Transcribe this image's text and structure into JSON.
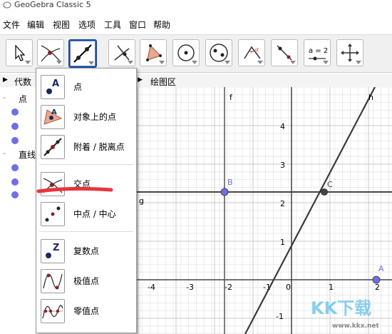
{
  "app": {
    "title": "GeoGebra Classic 5"
  },
  "menu": [
    "文件",
    "编辑",
    "视图",
    "选项",
    "工具",
    "窗口",
    "帮助"
  ],
  "toolbar": {
    "algebra_style_value": "a = 2",
    "selected_tool": "point-on-line"
  },
  "views": {
    "algebra_header": "代数",
    "graphics_header": "绘图区"
  },
  "algebra": {
    "group_points": "点",
    "group_lines": "直线"
  },
  "dropdown": {
    "items": [
      {
        "label": "点",
        "icon": "point-icon"
      },
      {
        "label": "对象上的点",
        "icon": "point-on-object-icon"
      },
      {
        "label": "附着 / 脱离点",
        "icon": "attach-detach-point-icon"
      },
      {
        "label": "交点",
        "icon": "intersect-icon"
      },
      {
        "label": "中点 / 中心",
        "icon": "midpoint-icon"
      },
      {
        "label": "复数点",
        "icon": "complex-number-icon"
      },
      {
        "label": "极值点",
        "icon": "extremum-icon"
      },
      {
        "label": "零值点",
        "icon": "roots-icon"
      }
    ],
    "highlighted": "交点"
  },
  "graphics": {
    "x_ticks": [
      "-4",
      "-3",
      "-2",
      "-1",
      "0",
      "1",
      "2"
    ],
    "y_ticks": [
      "4",
      "3",
      "2",
      "1",
      "-1"
    ],
    "labels": {
      "f": "f",
      "h": "h",
      "g": "g",
      "B": "B",
      "C": "C",
      "A": "A"
    }
  },
  "watermark": {
    "text": "KK下载",
    "url": "www.kkx.net"
  },
  "colors": {
    "accent": "#1a4a9c",
    "point": "#6f6fe6",
    "line": "#3a3a3a",
    "highlight": "#e8343a"
  }
}
